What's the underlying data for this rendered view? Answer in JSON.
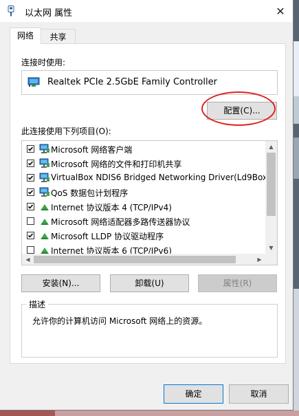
{
  "window": {
    "title": "以太网 属性",
    "close_glyph": "✕"
  },
  "tabs": [
    {
      "label": "网络",
      "active": true
    },
    {
      "label": "共享",
      "active": false
    }
  ],
  "connect_using": {
    "label": "连接时使用:",
    "adapter_name": "Realtek PCIe 2.5GbE Family Controller",
    "configure_button": "配置(C)..."
  },
  "items": {
    "label": "此连接使用下列项目(O):",
    "list": [
      {
        "text": "Microsoft 网络客户端",
        "checked": true,
        "icon": "network-client-icon"
      },
      {
        "text": "Microsoft 网络的文件和打印机共享",
        "checked": true,
        "icon": "network-client-icon"
      },
      {
        "text": "VirtualBox NDIS6 Bridged Networking Driver(Ld9Box...",
        "checked": true,
        "icon": "network-client-icon"
      },
      {
        "text": "QoS 数据包计划程序",
        "checked": true,
        "icon": "network-client-icon"
      },
      {
        "text": "Internet 协议版本 4 (TCP/IPv4)",
        "checked": true,
        "icon": "protocol-icon"
      },
      {
        "text": "Microsoft 网络适配器多路传送器协议",
        "checked": false,
        "icon": "protocol-icon"
      },
      {
        "text": "Microsoft LLDP 协议驱动程序",
        "checked": true,
        "icon": "protocol-icon"
      },
      {
        "text": "Internet 协议版本 6 (TCP/IPv6)",
        "checked": false,
        "icon": "protocol-icon"
      }
    ]
  },
  "actions": {
    "install": "安装(N)...",
    "uninstall": "卸载(U)",
    "properties": "属性(R)"
  },
  "description": {
    "title": "描述",
    "text": "允许你的计算机访问 Microsoft 网络上的资源。"
  },
  "footer": {
    "ok": "确定",
    "cancel": "取消"
  },
  "colors": {
    "accent": "#0078d7",
    "annotation_circle": "#e02020"
  }
}
